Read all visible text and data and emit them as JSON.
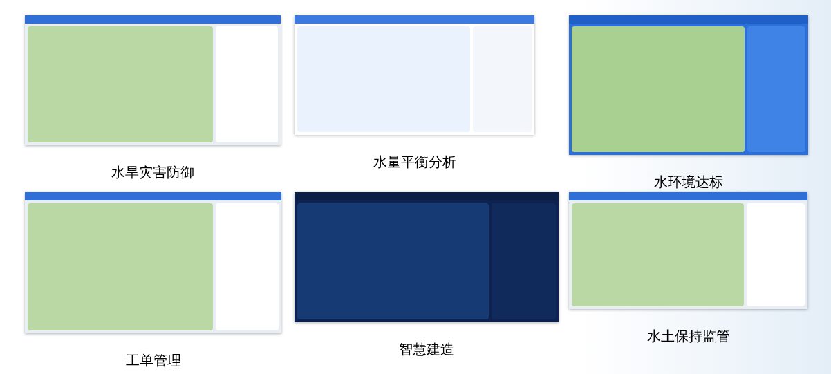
{
  "cards": [
    {
      "caption": "水旱灾害防御",
      "kind": "light"
    },
    {
      "caption": "水量平衡分析",
      "kind": "flow"
    },
    {
      "caption": "水环境达标",
      "kind": "blue"
    },
    {
      "caption": "工单管理",
      "kind": "light"
    },
    {
      "caption": "智慧建造",
      "kind": "dark"
    },
    {
      "caption": "水土保持监管",
      "kind": "light"
    }
  ]
}
